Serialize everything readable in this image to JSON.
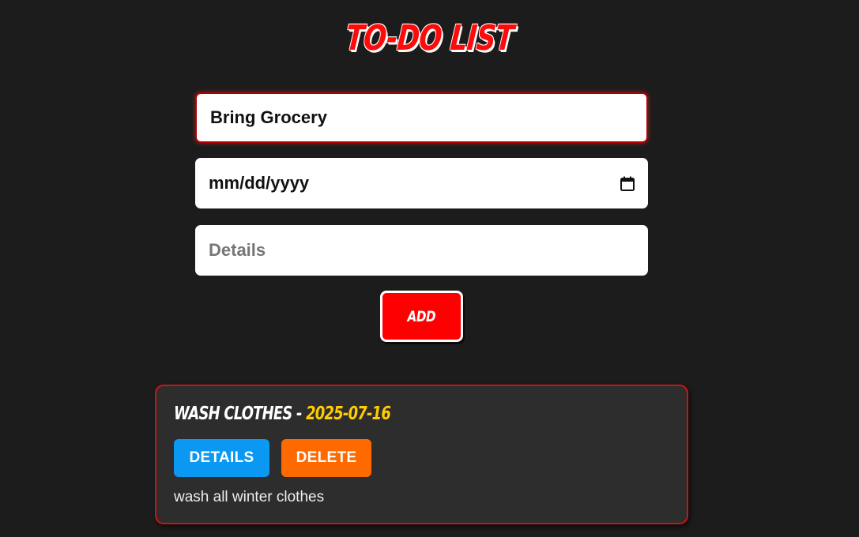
{
  "header": {
    "title": "TO-DO LIST"
  },
  "form": {
    "task_value": "Bring Grocery",
    "date_placeholder": "mm/dd/yyyy",
    "date_icon": "calendar-icon",
    "details_placeholder": "Details",
    "add_label": "ADD"
  },
  "tasks": [
    {
      "name": "WASH CLOTHES",
      "separator": " - ",
      "date": "2025-07-16",
      "details_label": "DETAILS",
      "delete_label": "DELETE",
      "description": "wash all winter clothes"
    }
  ],
  "colors": {
    "background": "#1c1c1c",
    "accent_red": "#ff0000",
    "date_yellow": "#ffcc00",
    "details_blue": "#0a98f2",
    "delete_orange": "#ff6a00",
    "card_bg": "#2d2d2d"
  }
}
